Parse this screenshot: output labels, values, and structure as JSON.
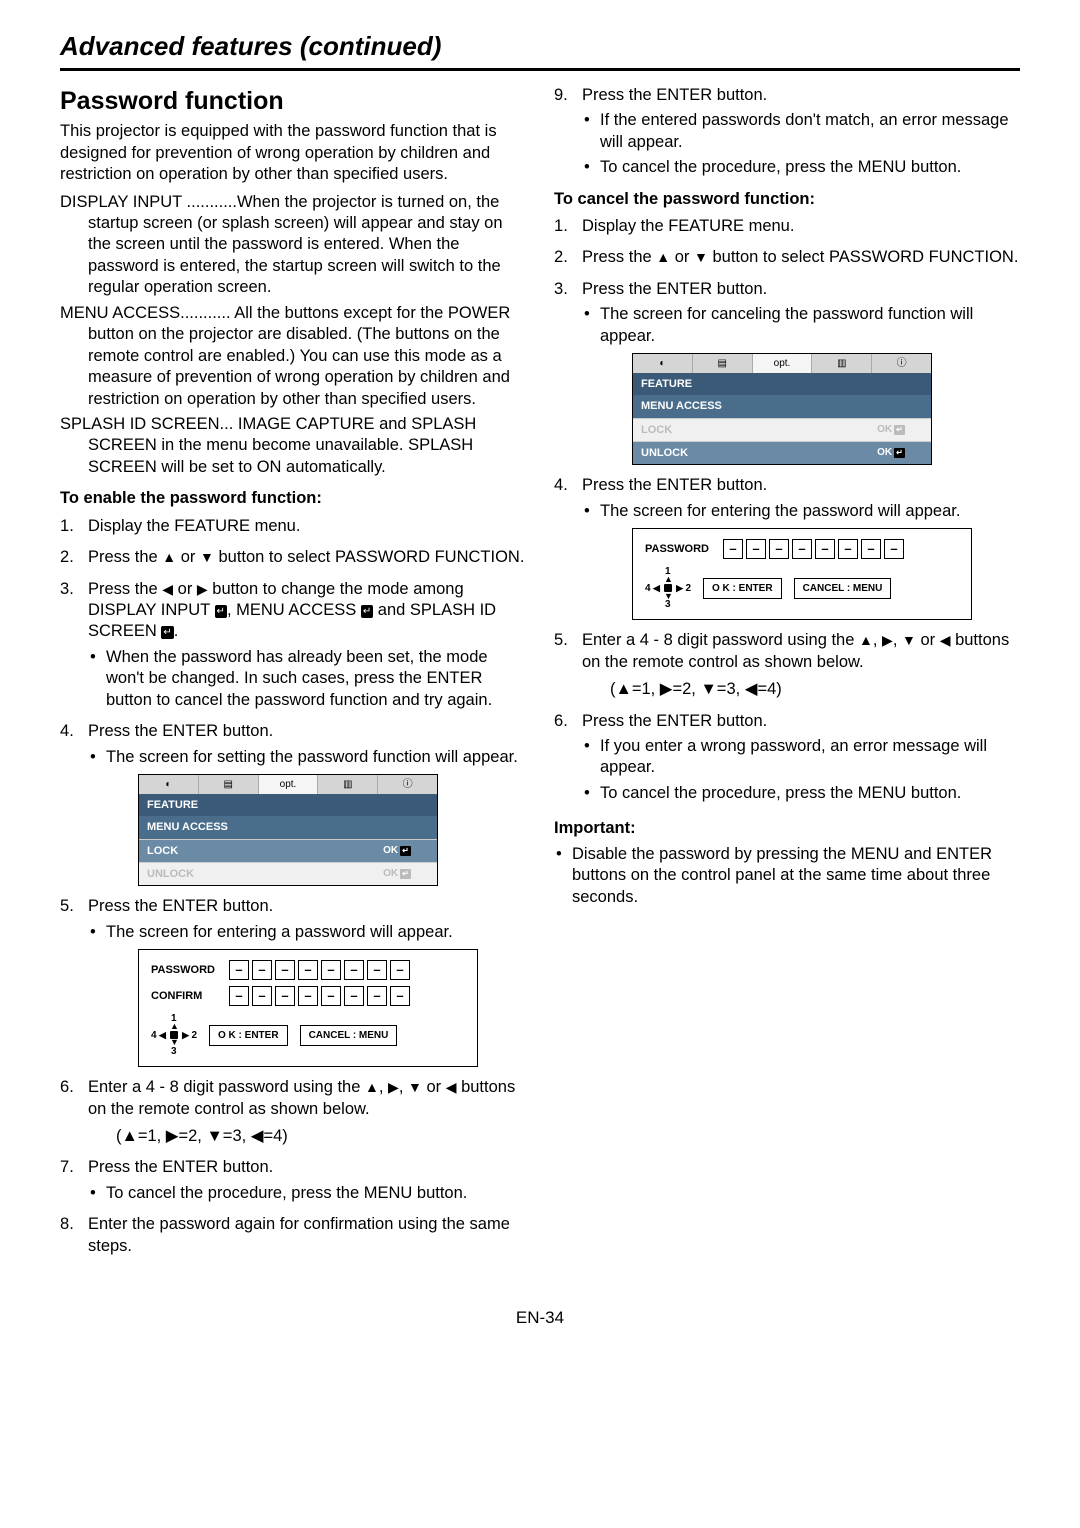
{
  "header": {
    "title": "Advanced features (continued)"
  },
  "left": {
    "title": "Password function",
    "intro": "This projector is equipped with the password function that is designed for prevention of wrong operation by children and restriction on operation by other than specified users.",
    "defs": [
      {
        "term": "DISPLAY INPUT ...........",
        "body": "When the projector is turned on, the startup screen (or splash screen) will appear and stay on the screen until the password is entered. When the password is entered, the startup screen will switch to the regular operation screen."
      },
      {
        "term": "MENU ACCESS........... ",
        "body": "All the buttons except for the POWER button on the projector are disabled. (The buttons on the remote control are enabled.) You can use this mode as a measure of prevention of wrong operation by children and restriction on operation by other than specified users."
      },
      {
        "term": "SPLASH ID SCREEN... ",
        "body": "IMAGE CAPTURE and SPLASH SCREEN in the menu become unavailable. SPLASH SCREEN will be set to ON automatically."
      }
    ],
    "enable_head": "To enable the password function:",
    "steps_a": [
      "Display the FEATURE menu.",
      "Press the ▲ or ▼ button to select PASSWORD FUNCTION.",
      "Press the ◀ or ▶ button to change the mode among DISPLAY INPUT ↵, MENU ACCESS ↵ and SPLASH ID SCREEN ↵.",
      "Press the ENTER button.",
      "Press the ENTER button.",
      "Enter a 4 - 8 digit password using the ▲, ▶, ▼ or ◀ buttons on the remote control as shown below.",
      "Press the ENTER button.",
      "Enter the password again for confirmation using the same steps."
    ],
    "step3_sub": "When the password has already been set, the mode won't be changed. In such cases, press the ENTER button to cancel the password function and try again.",
    "step4_sub": "The screen for setting the password function will appear.",
    "step5_sub": "The screen for entering a password will appear.",
    "step7_sub": "To cancel the procedure, press the MENU button.",
    "keymap": "(▲=1, ▶=2, ▼=3, ◀=4)",
    "menu1": {
      "feature": "FEATURE",
      "menuaccess": "MENU ACCESS",
      "lock": "LOCK",
      "unlock": "UNLOCK",
      "ok": "OK"
    },
    "pw1": {
      "password": "PASSWORD",
      "confirm": "CONFIRM",
      "ok": "O K : ENTER",
      "cancel": "CANCEL : MENU",
      "n1": "1",
      "n2": "2",
      "n3": "3",
      "n4": "4"
    }
  },
  "right": {
    "steps_b": [
      {
        "n": "9.",
        "t": "Press the ENTER button."
      }
    ],
    "s9_subs": [
      "If the entered passwords don't match, an error message will appear.",
      "To cancel the procedure, press the MENU button."
    ],
    "cancel_head": "To cancel the password function:",
    "steps_c": [
      "Display the FEATURE menu.",
      "Press the ▲ or ▼ button to select PASSWORD FUNCTION.",
      "Press the ENTER button.",
      "Press the ENTER button.",
      "Enter a 4 - 8 digit password using the ▲, ▶, ▼ or ◀ buttons on the remote control as shown below.",
      "Press the ENTER button."
    ],
    "c3_sub": "The screen for canceling the password function will appear.",
    "c4_sub": "The screen for entering the password will appear.",
    "c6_subs": [
      "If you enter a wrong password, an error message will appear.",
      "To cancel the procedure, press the MENU button."
    ],
    "keymap": "(▲=1, ▶=2, ▼=3, ◀=4)",
    "menu2": {
      "feature": "FEATURE",
      "menuaccess": "MENU ACCESS",
      "lock": "LOCK",
      "unlock": "UNLOCK",
      "ok": "OK"
    },
    "pw2": {
      "password": "PASSWORD",
      "ok": "O K : ENTER",
      "cancel": "CANCEL : MENU",
      "n1": "1",
      "n2": "2",
      "n3": "3",
      "n4": "4"
    },
    "important_head": "Important:",
    "important_body": "Disable the password by pressing the MENU and ENTER buttons on the control panel at the same time about three seconds."
  },
  "footer": "EN-34"
}
